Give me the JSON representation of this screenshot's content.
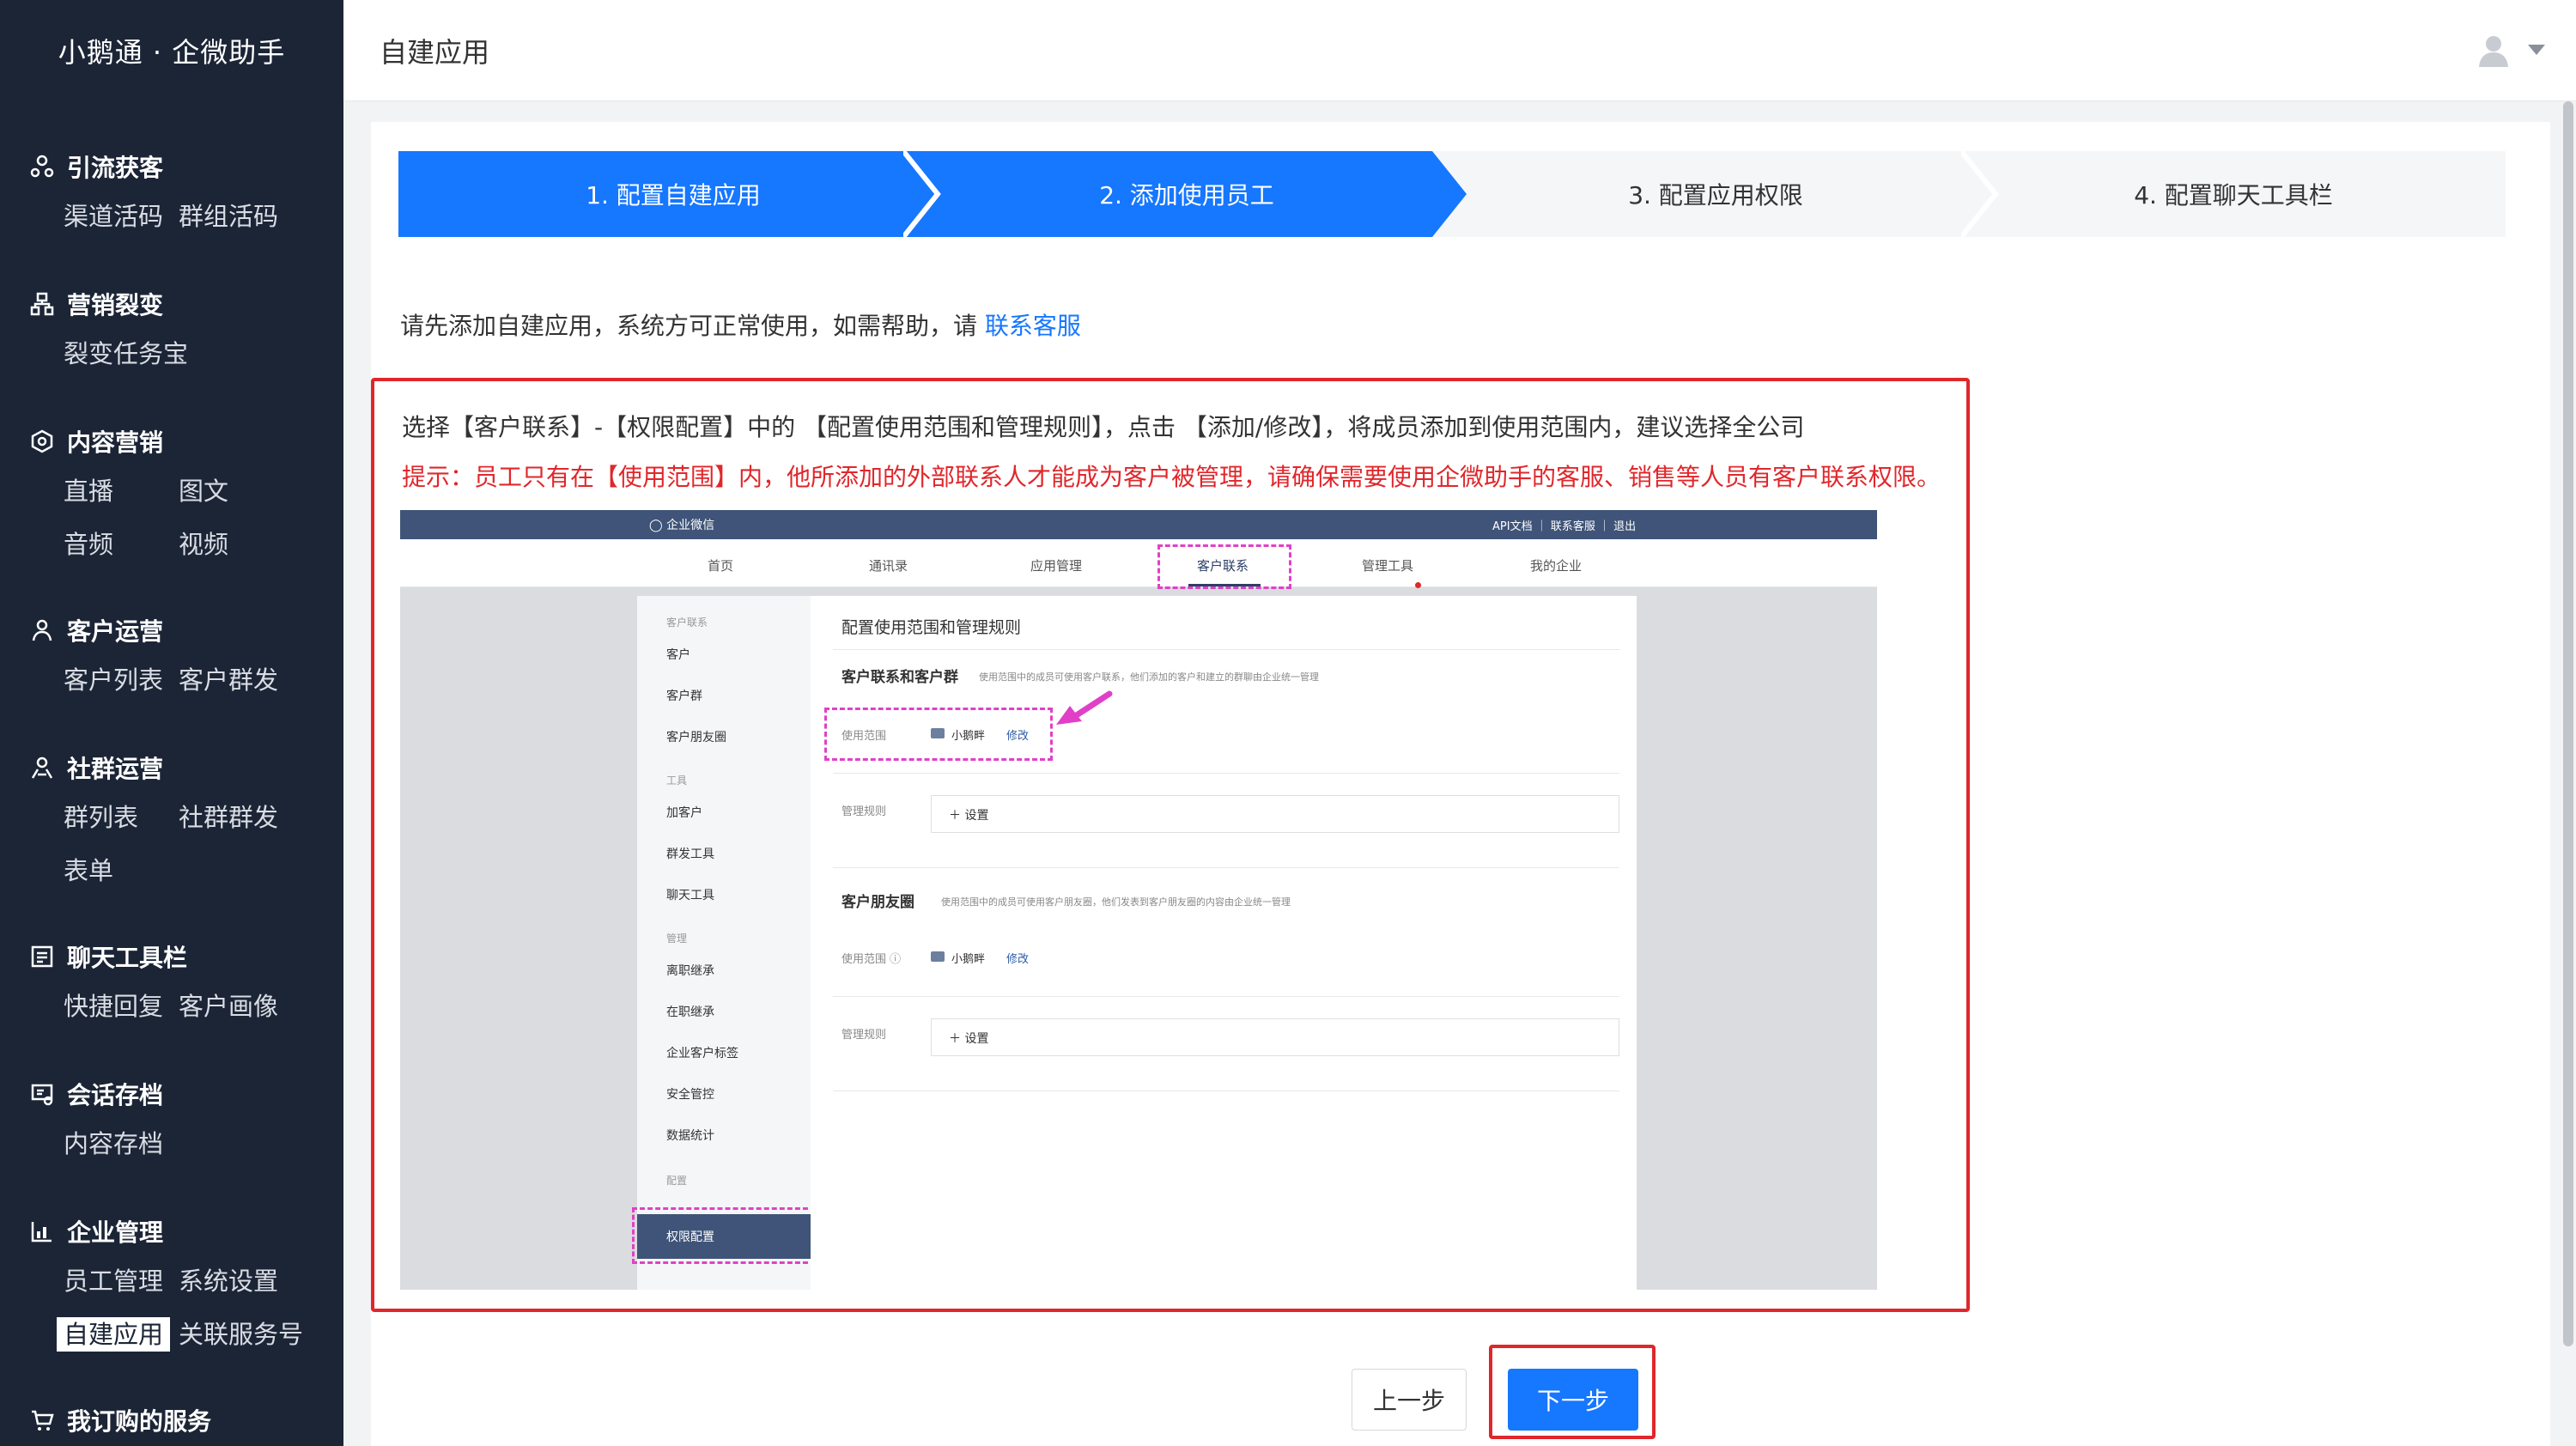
{
  "sidebar": {
    "brand": "小鹅通 · 企微助手",
    "groups": [
      {
        "title": "引流获客",
        "icon": "people-share-icon",
        "items": [
          "渠道活码",
          "群组活码"
        ]
      },
      {
        "title": "营销裂变",
        "icon": "org-tree-icon",
        "items": [
          "裂变任务宝"
        ]
      },
      {
        "title": "内容营销",
        "icon": "content-settings-icon",
        "items": [
          "直播",
          "图文",
          "音频",
          "视频"
        ]
      },
      {
        "title": "客户运营",
        "icon": "customer-icon",
        "items": [
          "客户列表",
          "客户群发"
        ]
      },
      {
        "title": "社群运营",
        "icon": "community-icon",
        "items": [
          "群列表",
          "社群群发",
          "表单"
        ]
      },
      {
        "title": "聊天工具栏",
        "icon": "chat-toolbar-icon",
        "items": [
          "快捷回复",
          "客户画像"
        ]
      },
      {
        "title": "会话存档",
        "icon": "archive-icon",
        "items": [
          "内容存档"
        ]
      },
      {
        "title": "企业管理",
        "icon": "enterprise-chart-icon",
        "items": [
          "员工管理",
          "系统设置",
          "自建应用",
          "关联服务号"
        ]
      },
      {
        "title": "我订购的服务",
        "icon": "cart-icon",
        "items": []
      }
    ],
    "active_item": "自建应用"
  },
  "header": {
    "title": "自建应用"
  },
  "steps": [
    {
      "label": "1. 配置自建应用",
      "state": "done"
    },
    {
      "label": "2. 添加使用员工",
      "state": "current"
    },
    {
      "label": "3. 配置应用权限",
      "state": "todo"
    },
    {
      "label": "4. 配置聊天工具栏",
      "state": "todo"
    }
  ],
  "help": {
    "text": "请先添加自建应用，系统方可正常使用，如需帮助，请 ",
    "link": "联系客服"
  },
  "instruction": {
    "text": "选择【客户联系】-【权限配置】中的 【配置使用范围和管理规则】，点击 【添加/修改】，将成员添加到使用范围内，建议选择全公司",
    "warning": "提示：员工只有在【使用范围】内，他所添加的外部联系人才能成为客户被管理，请确保需要使用企微助手的客服、销售等人员有客户联系权限。"
  },
  "mock": {
    "logo": "企业微信",
    "top_links": "API文档 ｜ 联系客服 ｜ 退出",
    "nav": [
      "首页",
      "通讯录",
      "应用管理",
      "客户联系",
      "管理工具",
      "我的企业"
    ],
    "side": {
      "sections": [
        {
          "title": "客户联系",
          "items": [
            "客户",
            "客户群",
            "客户朋友圈"
          ]
        },
        {
          "title": "工具",
          "items": [
            "加客户",
            "群发工具",
            "聊天工具"
          ]
        },
        {
          "title": "管理",
          "items": [
            "离职继承",
            "在职继承",
            "企业客户标签",
            "安全管控",
            "数据统计"
          ]
        },
        {
          "title": "配置",
          "items": []
        }
      ],
      "active": "权限配置"
    },
    "main": {
      "title": "配置使用范围和管理规则",
      "sec1_title": "客户联系和客户群",
      "sec1_note": "使用范围中的成员可使用客户联系，他们添加的客户和建立的群聊由企业统一管理",
      "range_label": "使用范围",
      "range_value": "小鹅畔",
      "edit_link": "修改",
      "rule_label": "管理规则",
      "set_label": "＋ 设置",
      "sec2_title": "客户朋友圈",
      "sec2_note": "使用范围中的成员可使用客户朋友圈，他们发表到客户朋友圈的内容由企业统一管理",
      "range_label2": "使用范围 ⓘ",
      "range_value2": "小鹅畔",
      "edit_link2": "修改",
      "rule_label2": "管理规则",
      "set_label2": "＋ 设置"
    }
  },
  "buttons": {
    "prev": "上一步",
    "next": "下一步"
  },
  "colors": {
    "primary": "#1677ff",
    "sidebar_bg": "#1c2536",
    "highlight_red": "#e0272b",
    "dash_magenta": "#e040c8"
  }
}
